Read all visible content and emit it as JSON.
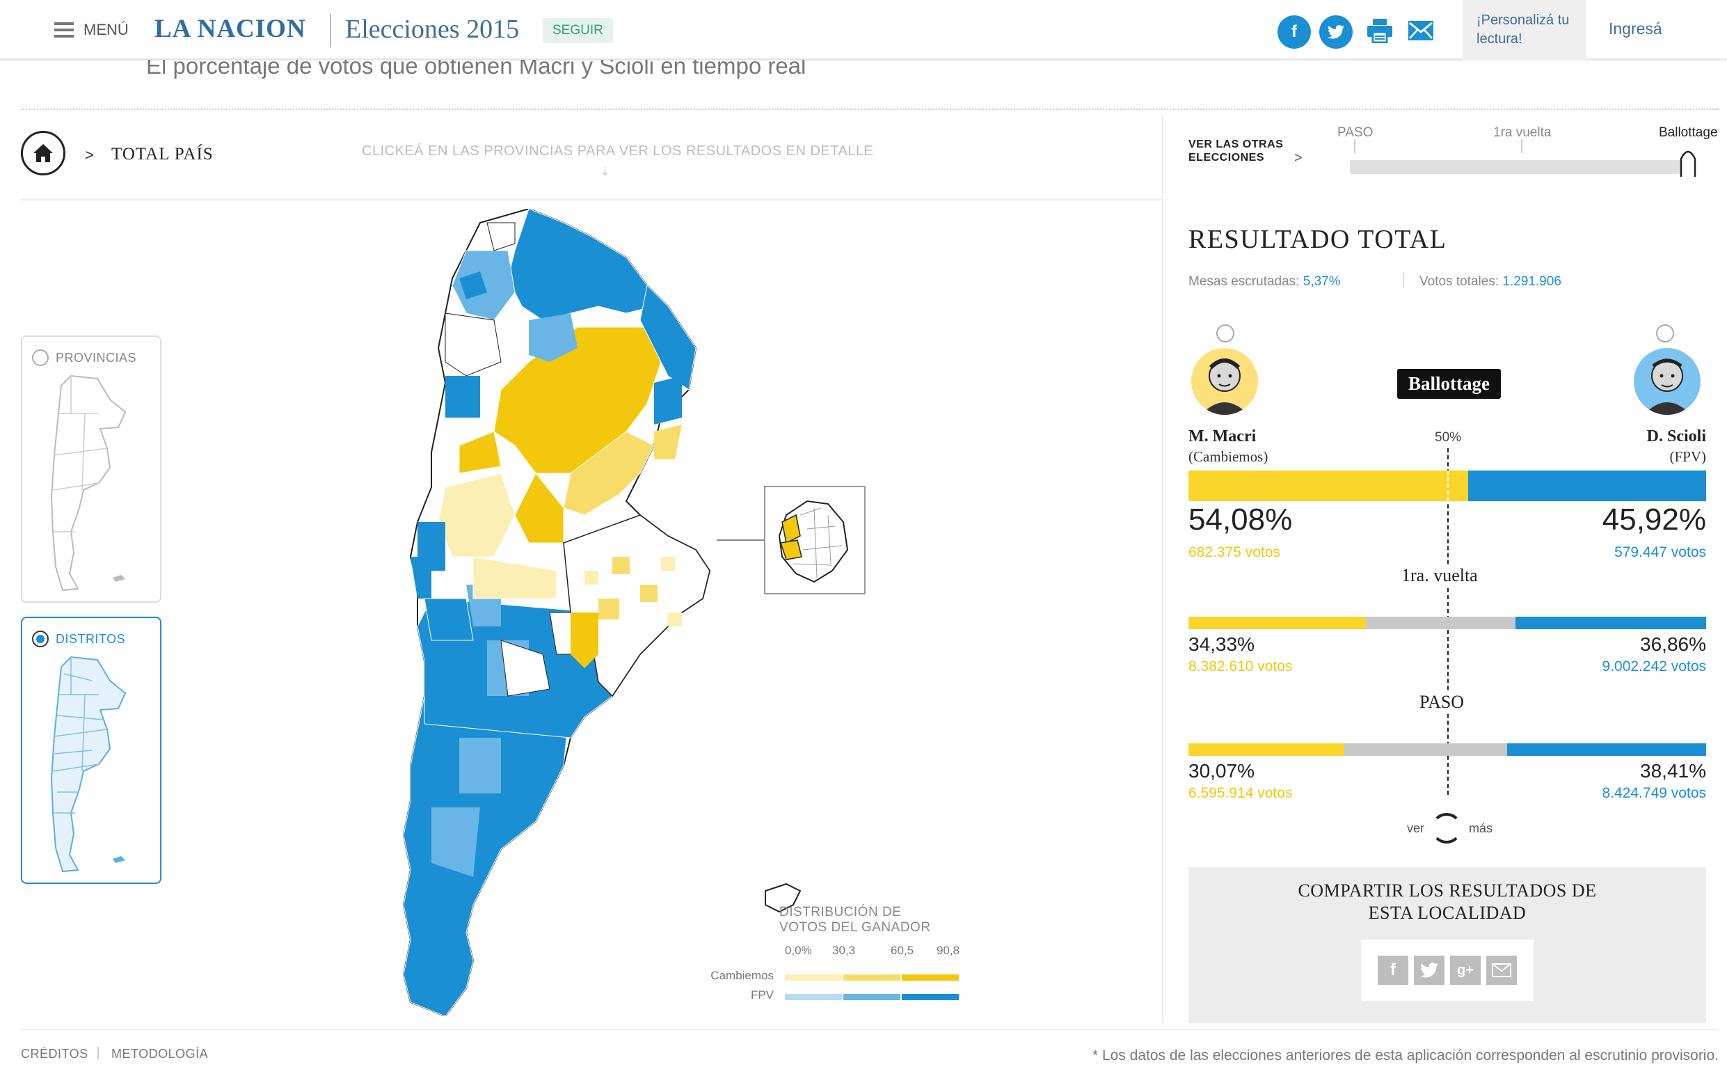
{
  "header": {
    "menu_label": "MENÚ",
    "logo": "LA NACION",
    "section": "Elecciones 2015",
    "follow_label": "SEGUIR",
    "personalize": "¡Personalizá tu lectura!",
    "login": "Ingresá",
    "colors": {
      "facebook": "#1a8fd3",
      "twitter": "#1a8fd3",
      "brand": "#2f6da6"
    }
  },
  "subtitle": "El porcentaje de votos que obtienen Macri y Scioli en tiempo real",
  "nav": {
    "breadcrumb": "TOTAL PAÍS",
    "hint": "CLICKEÁ EN LAS PROVINCIAS PARA VER LOS RESULTADOS EN DETALLE",
    "other_elections": "VER LAS OTRAS ELECCIONES",
    "timeline": [
      "PASO",
      "1ra vuelta",
      "Ballottage"
    ],
    "selected_election": "Ballottage"
  },
  "map_views": {
    "provinces": "PROVINCIAS",
    "districts": "DISTRITOS",
    "selected": "DISTRITOS"
  },
  "legend": {
    "title": "DISTRIBUCIÓN DE VOTOS DEL GANADOR",
    "ticks": [
      "0,0%",
      "30,3",
      "60,5",
      "90,8"
    ],
    "rows": [
      {
        "label": "Cambiemos",
        "colors": [
          "#fbefb4",
          "#f8dc6a",
          "#f2c70c"
        ]
      },
      {
        "label": "FPV",
        "colors": [
          "#b8dbf2",
          "#68b5e6",
          "#1a8fd3"
        ]
      }
    ]
  },
  "results": {
    "title": "RESULTADO TOTAL",
    "mesas_label": "Mesas escrutadas:",
    "mesas_value": "5,37%",
    "votos_label": "Votos totales:",
    "votos_value": "1.291.906",
    "badge": "Ballottage",
    "midpoint": "50%",
    "left": {
      "name": "M. Macri",
      "party": "(Cambiemos)",
      "color": "#fbd62a"
    },
    "right": {
      "name": "D. Scioli",
      "party": "(FPV)",
      "color": "#1a8fd3"
    },
    "rounds": [
      {
        "label": "",
        "left_pct": "54,08%",
        "left_votes": "682.375 votos",
        "right_pct": "45,92%",
        "right_votes": "579.447 votos",
        "left_share": 54.08,
        "right_share": 45.92
      },
      {
        "label": "1ra. vuelta",
        "left_pct": "34,33%",
        "left_votes": "8.382.610 votos",
        "right_pct": "36,86%",
        "right_votes": "9.002.242 votos",
        "left_share": 34.33,
        "right_share": 36.86
      },
      {
        "label": "PASO",
        "left_pct": "30,07%",
        "left_votes": "6.595.914 votos",
        "right_pct": "38,41%",
        "right_votes": "8.424.749 votos",
        "left_share": 30.07,
        "right_share": 38.41
      }
    ],
    "ver": "ver",
    "mas": "más"
  },
  "share": {
    "title": "COMPARTIR LOS RESULTADOS DE ESTA LOCALIDAD",
    "icons": [
      "facebook-icon",
      "twitter-icon",
      "googleplus-icon",
      "email-icon"
    ]
  },
  "footer": {
    "credits": "CRÉDITOS",
    "methodology": "METODOLOGÍA",
    "note": "* Los datos de las elecciones anteriores de esta aplicación corresponden al escrutinio provisorio."
  }
}
